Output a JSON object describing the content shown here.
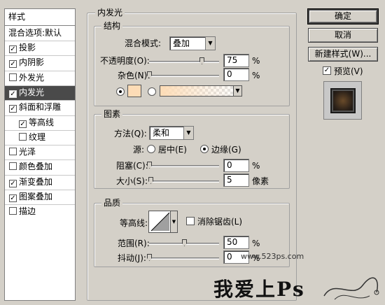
{
  "styles": {
    "header": "样式",
    "blend_option": "混合选项:默认",
    "items": [
      {
        "label": "投影",
        "checked": true,
        "indent": false,
        "selected": false
      },
      {
        "label": "内阴影",
        "checked": true,
        "indent": false,
        "selected": false
      },
      {
        "label": "外发光",
        "checked": false,
        "indent": false,
        "selected": false
      },
      {
        "label": "内发光",
        "checked": true,
        "indent": false,
        "selected": true
      },
      {
        "label": "斜面和浮雕",
        "checked": true,
        "indent": false,
        "selected": false
      },
      {
        "label": "等高线",
        "checked": true,
        "indent": true,
        "selected": false
      },
      {
        "label": "纹理",
        "checked": false,
        "indent": true,
        "selected": false
      },
      {
        "label": "光泽",
        "checked": false,
        "indent": false,
        "selected": false
      },
      {
        "label": "颜色叠加",
        "checked": false,
        "indent": false,
        "selected": false
      },
      {
        "label": "渐变叠加",
        "checked": true,
        "indent": false,
        "selected": false
      },
      {
        "label": "图案叠加",
        "checked": true,
        "indent": false,
        "selected": false
      },
      {
        "label": "描边",
        "checked": false,
        "indent": false,
        "selected": false
      }
    ]
  },
  "inner_glow": {
    "title": "内发光",
    "structure": {
      "title": "结构",
      "blend_mode_label": "混合模式:",
      "blend_mode_value": "叠加",
      "opacity_label": "不透明度(O):",
      "opacity_value": "75",
      "opacity_fraction": 0.75,
      "noise_label": "杂色(N):",
      "noise_value": "0",
      "noise_fraction": 0.0,
      "percent": "%",
      "color_swatch": "#fddcb6",
      "color_radio_selected": true
    },
    "elements": {
      "title": "图素",
      "method_label": "方法(Q):",
      "method_value": "柔和",
      "source_label": "源:",
      "source_center": "居中(E)",
      "source_edge": "边缘(G)",
      "source_selected": "edge",
      "choke_label": "阻塞(C):",
      "choke_value": "0",
      "choke_fraction": 0.0,
      "size_label": "大小(S):",
      "size_value": "5",
      "size_fraction": 0.02,
      "percent": "%",
      "pixels": "像素"
    },
    "quality": {
      "title": "品质",
      "contour_label": "等高线:",
      "anti_alias_label": "消除锯齿(L)",
      "anti_alias_checked": false,
      "range_label": "范围(R):",
      "range_value": "50",
      "range_fraction": 0.5,
      "jitter_label": "抖动(J):",
      "jitter_value": "0",
      "jitter_fraction": 0.0,
      "percent": "%"
    }
  },
  "buttons": {
    "ok": "确定",
    "cancel": "取消",
    "new_style": "新建样式(W)...",
    "preview_label": "预览(V)",
    "preview_checked": true
  },
  "watermark": {
    "url": "www.523ps.com",
    "text": "我爱上Ps"
  }
}
